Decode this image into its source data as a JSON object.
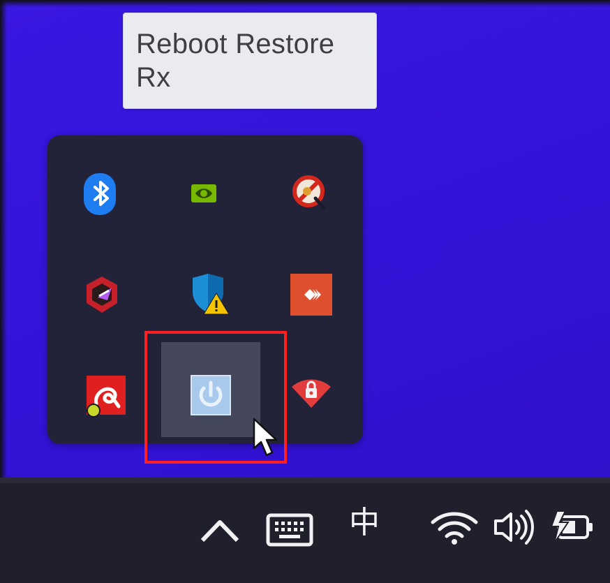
{
  "tooltip": {
    "line1": "Reboot Restore",
    "line2": "Rx"
  },
  "tray_flyout": {
    "icons": [
      {
        "name": "bluetooth-icon",
        "color": "#1e7df0"
      },
      {
        "name": "nvidia-icon",
        "color": "#76b900"
      },
      {
        "name": "network-tool-icon",
        "color": "#d3271e"
      },
      {
        "name": "graphics-utility-icon",
        "color": "#c8202a"
      },
      {
        "name": "windows-security-warning-icon",
        "color": "#1c8fd6"
      },
      {
        "name": "anydesk-icon",
        "color": "#e0502e"
      },
      {
        "name": "avira-icon",
        "color": "#e02020"
      },
      {
        "name": "reboot-restore-rx-icon",
        "color": "#a9c9ec"
      },
      {
        "name": "wifi-lock-icon",
        "color": "#e23c3c"
      }
    ],
    "hovered_item": "reboot-restore-rx-icon"
  },
  "taskbar": {
    "show_hidden_icons": "^",
    "ime_indicator": "中",
    "icons": [
      "chevron-up-icon",
      "touch-keyboard-icon",
      "wifi-icon",
      "speaker-icon",
      "battery-charging-icon"
    ]
  },
  "colors": {
    "desktop": "#3413d9",
    "flyout": "#222238",
    "taskbar": "#20202c",
    "highlight": "#ff1f1f"
  }
}
